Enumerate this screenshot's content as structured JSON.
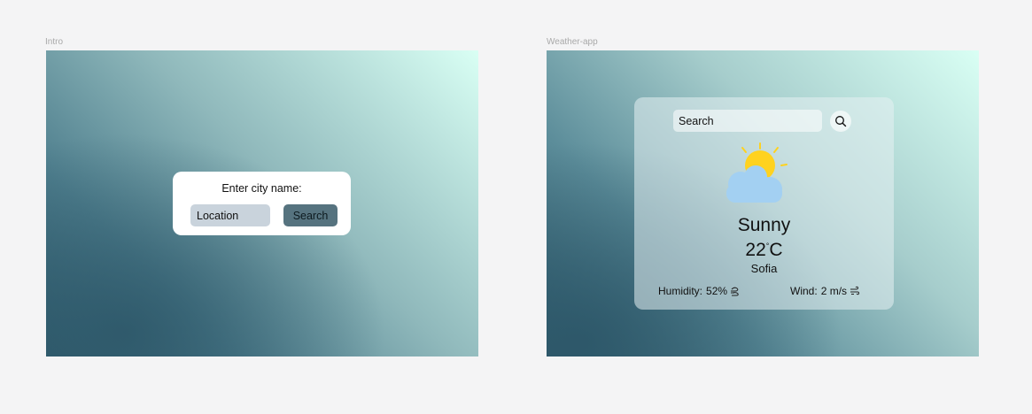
{
  "frames": {
    "intro_label": "Intro",
    "weather_label": "Weather-app"
  },
  "intro": {
    "title": "Enter city name:",
    "location_placeholder": "Location",
    "search_label": "Search"
  },
  "weather": {
    "search_placeholder": "Search",
    "condition": "Sunny",
    "temperature_value": "22",
    "temperature_degree": "°",
    "temperature_unit": "C",
    "city": "Sofia",
    "humidity_label": "Humidity:",
    "humidity_value": "52%",
    "wind_label": "Wind:",
    "wind_value": "2 m/s",
    "icons": {
      "search": "search-icon",
      "weather": "sun-cloud-icon",
      "humidity": "humidity-icon",
      "wind": "wind-icon"
    }
  },
  "colors": {
    "canvas_bg": "#f4f4f5",
    "gradient_light": "#d9fff4",
    "gradient_dark": "#325f70",
    "intro_button": "#56737f",
    "location_input": "#c9d3dc",
    "sun": "#ffd21f",
    "cloud": "#a3d0f2"
  }
}
